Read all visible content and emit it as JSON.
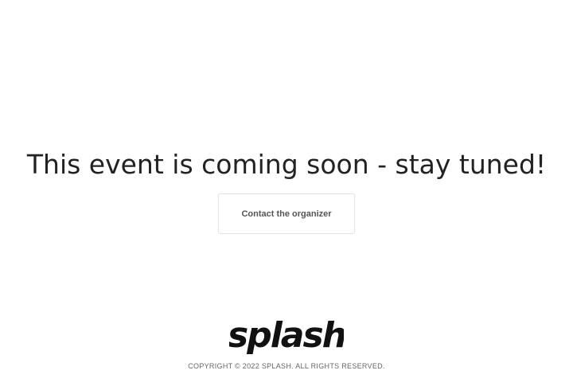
{
  "main": {
    "headline": "This event is coming soon - stay tuned!",
    "contact_button_label": "Contact the organizer"
  },
  "footer": {
    "logo_text": "splash",
    "copyright": "COPYRIGHT © 2022 SPLASH. ALL RIGHTS RESERVED."
  },
  "colors": {
    "text": "#222222",
    "button_border": "#e2e2e2",
    "button_text": "#555555",
    "background": "#ffffff"
  }
}
